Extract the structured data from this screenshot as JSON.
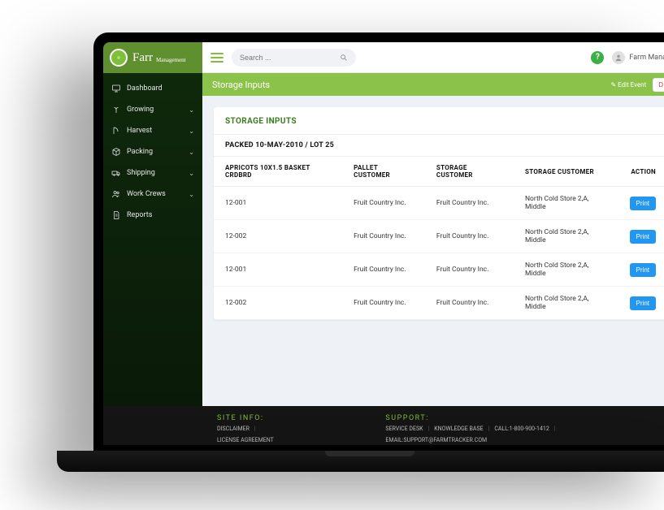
{
  "brand": {
    "name": "Farr",
    "sub": "Management"
  },
  "sidebar": {
    "items": [
      {
        "label": "Dashboard",
        "icon": "monitor",
        "expandable": false
      },
      {
        "label": "Growing",
        "icon": "sprout",
        "expandable": true
      },
      {
        "label": "Harvest",
        "icon": "scythe",
        "expandable": true
      },
      {
        "label": "Packing",
        "icon": "box",
        "expandable": true
      },
      {
        "label": "Shipping",
        "icon": "truck",
        "expandable": true
      },
      {
        "label": "Work Crews",
        "icon": "people",
        "expandable": true
      },
      {
        "label": "Reports",
        "icon": "doc",
        "expandable": false
      }
    ]
  },
  "topbar": {
    "search_placeholder": "Search ...",
    "help": "?",
    "user_label": "Farm Manag"
  },
  "page": {
    "title": "Storage Inputs",
    "edit_label": "Edit Event",
    "delete_label": "D"
  },
  "card": {
    "title": "STORAGE INPUTS",
    "lot_line": "PACKED 10-MAY-2010 / LOT 25",
    "columns": [
      "APRICOTS 10X1.5 BASKET CRDBRD",
      "PALLET CUSTOMER",
      "STORAGE CUSTOMER",
      "STORAGE CUSTOMER",
      "ACTION"
    ],
    "rows": [
      {
        "code": "12-001",
        "pallet": "Fruit Country Inc.",
        "storage1": "Fruit Country Inc.",
        "storage2": "North Cold Store 2,A, Middle",
        "action": "Print"
      },
      {
        "code": "12-002",
        "pallet": "Fruit Country Inc.",
        "storage1": "Fruit Country Inc.",
        "storage2": "North Cold Store 2,A, Middle",
        "action": "Print"
      },
      {
        "code": "12-001",
        "pallet": "Fruit Country Inc.",
        "storage1": "Fruit Country Inc.",
        "storage2": "North Cold Store 2,A, Middle",
        "action": "Print"
      },
      {
        "code": "12-002",
        "pallet": "Fruit Country Inc.",
        "storage1": "Fruit Country Inc.",
        "storage2": "North Cold Store 2,A, Middle",
        "action": "Print"
      }
    ]
  },
  "footer": {
    "site_title": "SITE INFO:",
    "site_links": [
      "DISCLAIMER",
      "LICENSE AGREEMENT"
    ],
    "support_title": "SUPPORT:",
    "support_links": [
      "SERVICE DESK",
      "KNOWLEDGE BASE",
      "CALL:1-800-900-1412",
      "EMAIL:SUPPORT@FARMTRACKER.COM"
    ]
  }
}
